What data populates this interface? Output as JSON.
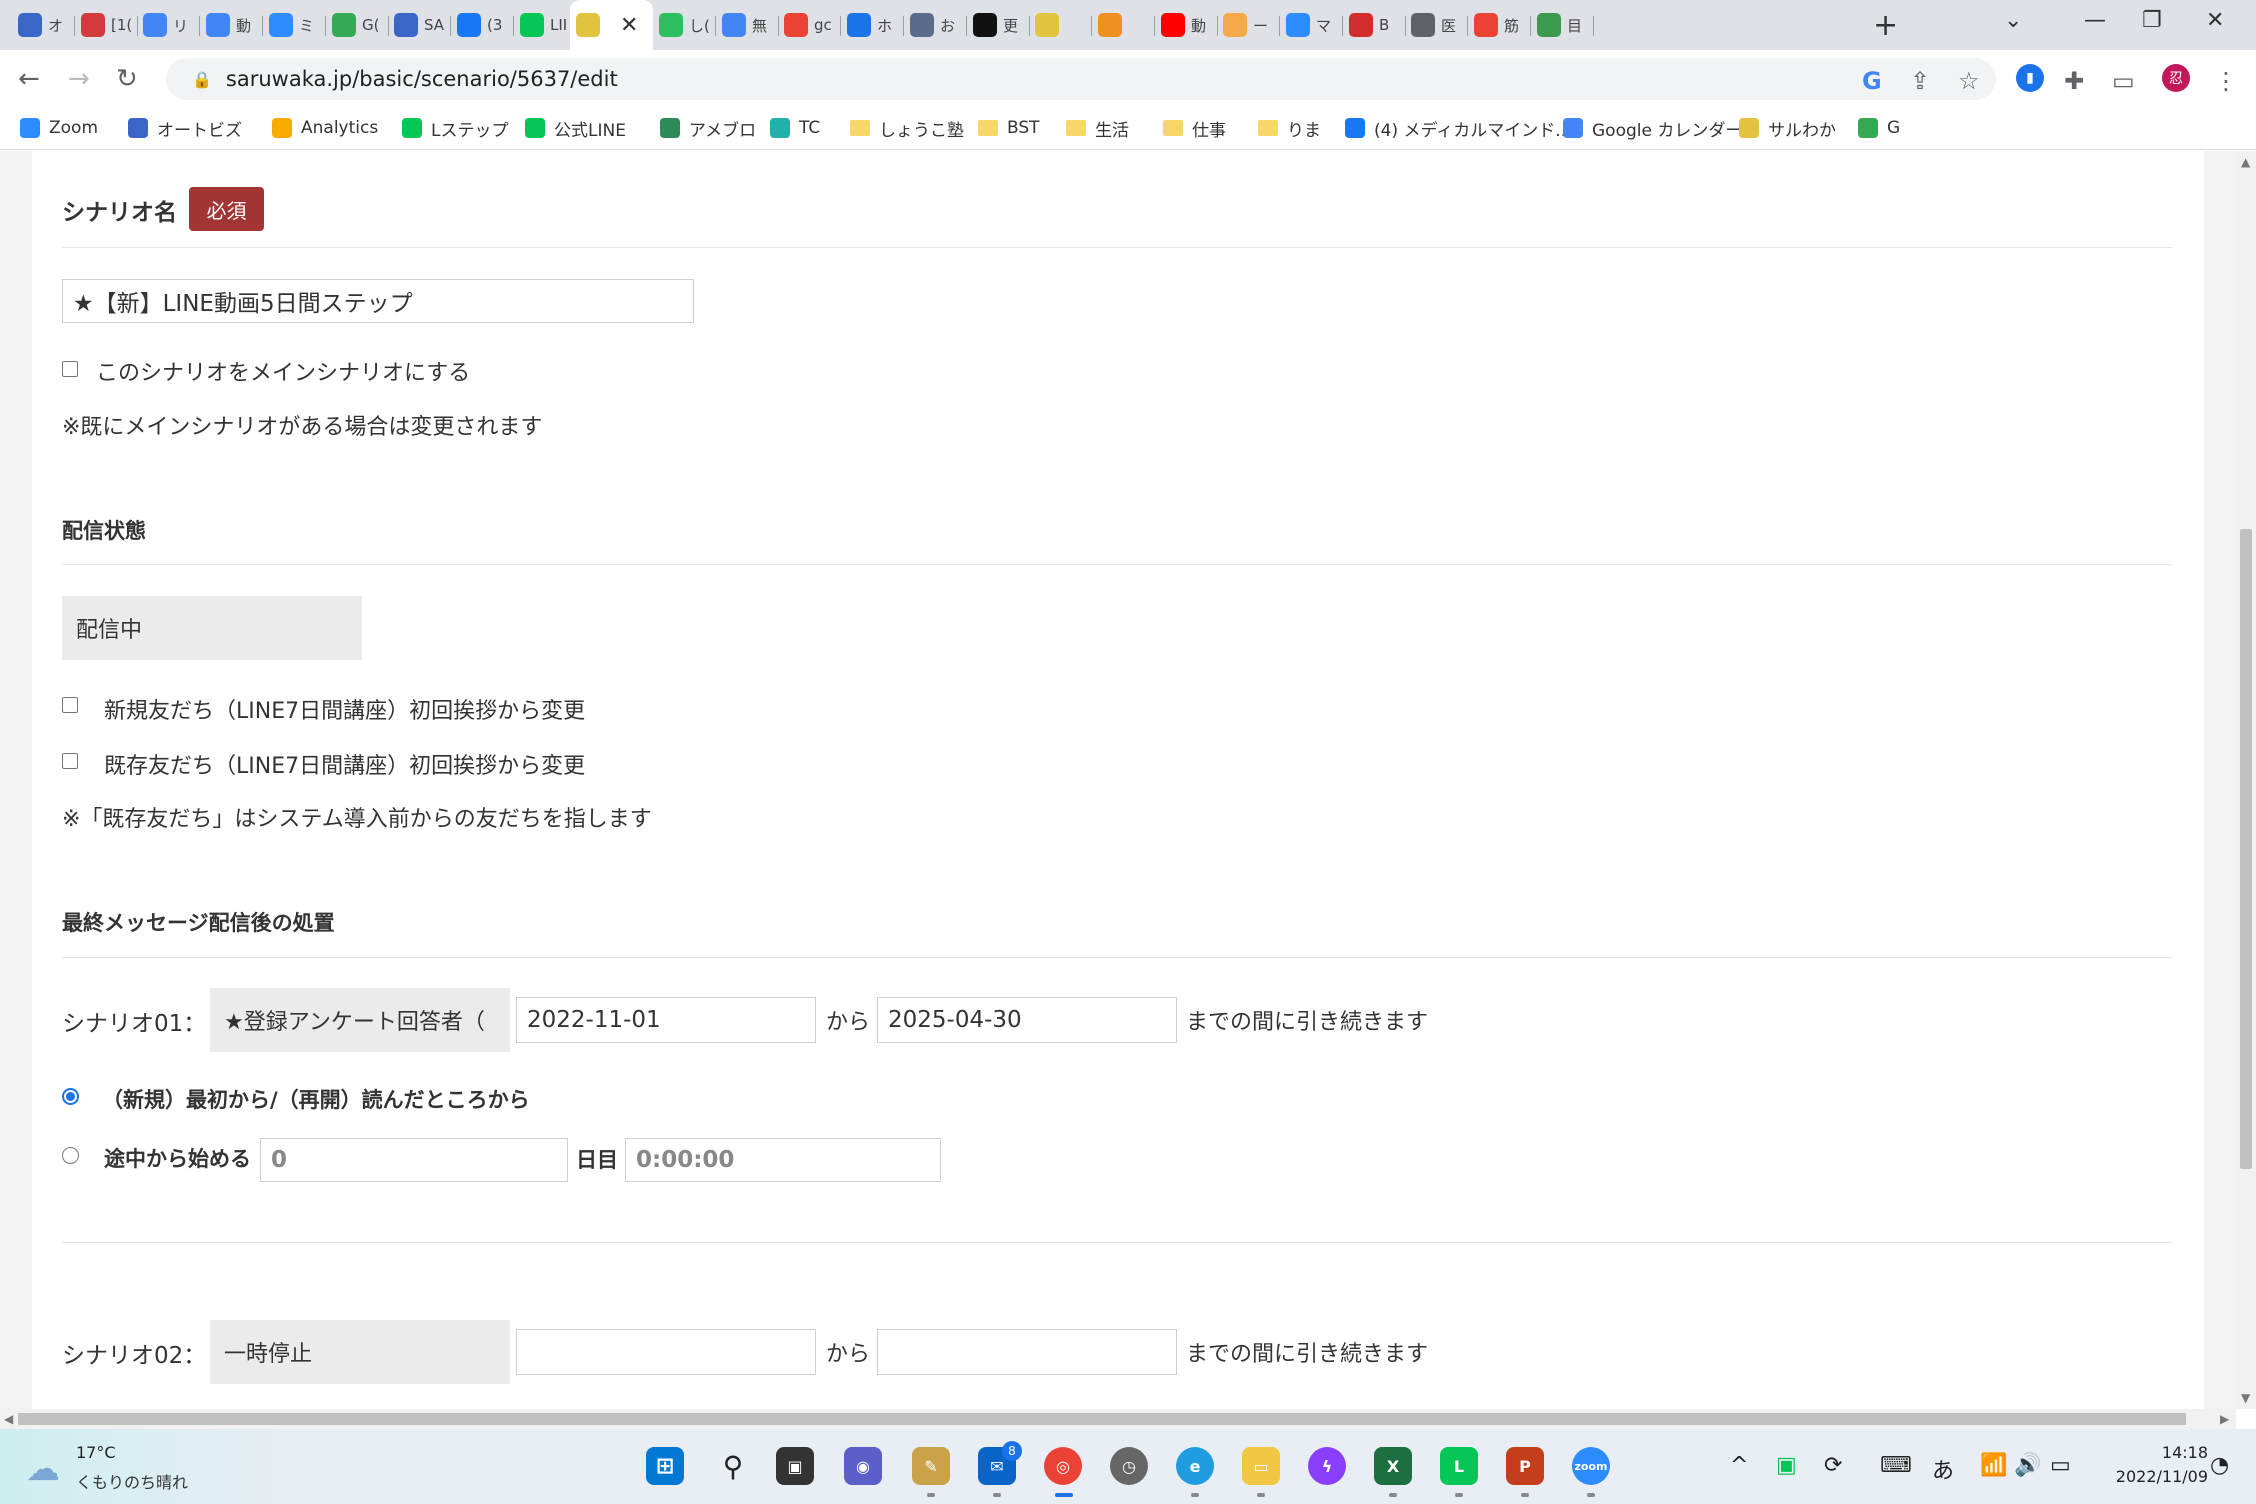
{
  "browser": {
    "tabs": [
      {
        "label": "オ",
        "icon": "beta-icon",
        "color": "#3a66c9"
      },
      {
        "label": "[1(",
        "icon": "flower-icon",
        "color": "#d23b3b"
      },
      {
        "label": "リ",
        "icon": "docs-icon",
        "color": "#4285f4"
      },
      {
        "label": "動",
        "icon": "docs-icon",
        "color": "#4285f4"
      },
      {
        "label": "ミ",
        "icon": "zoom-icon",
        "color": "#2d8cff"
      },
      {
        "label": "G(",
        "icon": "calendar-icon",
        "color": "#34a853"
      },
      {
        "label": "SA",
        "icon": "b-icon",
        "color": "#3a66c9"
      },
      {
        "label": "(3",
        "icon": "facebook-icon",
        "color": "#1877f2"
      },
      {
        "label": "LII",
        "icon": "line-shield-icon",
        "color": "#06c755"
      },
      {
        "label": "",
        "icon": "monkey-icon",
        "color": "#e3c441",
        "active": true
      },
      {
        "label": "し(",
        "icon": "evernote-icon",
        "color": "#2dbe60"
      },
      {
        "label": "無",
        "icon": "docs-icon",
        "color": "#4285f4"
      },
      {
        "label": "gc",
        "icon": "google-icon",
        "color": "#ea4335"
      },
      {
        "label": "ホ",
        "icon": "e-icon",
        "color": "#1a73e8"
      },
      {
        "label": "お",
        "icon": "zine-icon",
        "color": "#5b6b8c"
      },
      {
        "label": "更",
        "icon": "k-icon",
        "color": "#111111"
      },
      {
        "label": "",
        "icon": "monkey-icon",
        "color": "#e3c441"
      },
      {
        "label": "",
        "icon": "t-icon",
        "color": "#f09020"
      },
      {
        "label": "動",
        "icon": "youtube-icon",
        "color": "#ff0000"
      },
      {
        "label": "ー",
        "icon": "orange-star-icon",
        "color": "#f6a94a"
      },
      {
        "label": "マ",
        "icon": "zoom-icon",
        "color": "#2d8cff"
      },
      {
        "label": "B",
        "icon": "alpha-icon",
        "color": "#d22d2d"
      },
      {
        "label": "医",
        "icon": "globe-icon",
        "color": "#5f6368"
      },
      {
        "label": "筋",
        "icon": "google-icon",
        "color": "#ea4335"
      },
      {
        "label": "目",
        "icon": "frog-icon",
        "color": "#3c9a4e"
      }
    ],
    "active_tab_close": "✕",
    "new_tab": "+",
    "url": "saruwaka.jp/basic/scenario/5637/edit",
    "profile_initial": "忍",
    "bookmarks": [
      {
        "label": "Zoom",
        "icon": "zoom-icon",
        "color": "#2d8cff"
      },
      {
        "label": "オートビズ",
        "icon": "beta-icon",
        "color": "#3a66c9"
      },
      {
        "label": "Analytics",
        "icon": "analytics-icon",
        "color": "#f9ab00"
      },
      {
        "label": "Lステップ",
        "icon": "lstep-icon",
        "color": "#06c755"
      },
      {
        "label": "公式LINE",
        "icon": "line-shield-icon",
        "color": "#06c755"
      },
      {
        "label": "アメブロ",
        "icon": "ameba-icon",
        "color": "#2e8b57"
      },
      {
        "label": "TC",
        "icon": "tc-icon",
        "color": "#20b2aa"
      },
      {
        "label": "しょうこ塾",
        "icon": "folder-icon",
        "color": "#f7d76a"
      },
      {
        "label": "BST",
        "icon": "folder-icon",
        "color": "#f7d76a"
      },
      {
        "label": "生活",
        "icon": "folder-icon",
        "color": "#f7d76a"
      },
      {
        "label": "仕事",
        "icon": "folder-icon",
        "color": "#f7d76a"
      },
      {
        "label": "りま",
        "icon": "folder-icon",
        "color": "#f7d76a"
      },
      {
        "label": "(4) メディカルマインド...",
        "icon": "facebook-icon",
        "color": "#1877f2"
      },
      {
        "label": "Google カレンダー",
        "icon": "calendar-icon",
        "color": "#4285f4"
      },
      {
        "label": "サルわか",
        "icon": "monkey-icon",
        "color": "#e3c441"
      },
      {
        "label": "G",
        "icon": "drive-icon",
        "color": "#34a853"
      }
    ]
  },
  "form": {
    "scenario_name": {
      "label": "シナリオ名",
      "required_badge": "必須",
      "value": "★【新】LINE動画5日間ステップ",
      "main_checkbox_label": "このシナリオをメインシナリオにする",
      "main_note": "※既にメインシナリオがある場合は変更されます"
    },
    "delivery": {
      "label": "配信状態",
      "status": "配信中",
      "new_friends_label": "新規友だち（LINE7日間講座）初回挨拶から変更",
      "existing_friends_label": "既存友だち（LINE7日間講座）初回挨拶から変更",
      "note": "※「既存友だち」はシステム導入前からの友だちを指します"
    },
    "final": {
      "label": "最終メッセージ配信後の処置",
      "from_text": "から",
      "until_text": "までの間に引き続きます",
      "scenario01": {
        "label": "シナリオ01：",
        "target": "★登録アンケート回答者（",
        "start_date": "2022-11-01",
        "end_date": "2025-04-30"
      },
      "option_restart_label": "（新規）最初から/（再開）読んだところから",
      "option_midway_label": "途中から始める",
      "day_value": "0",
      "day_unit": "日目",
      "time_value": "0:00:00",
      "scenario02": {
        "label": "シナリオ02：",
        "target": "一時停止",
        "start_date": "",
        "end_date": ""
      }
    }
  },
  "taskbar": {
    "weather_temp": "17°C",
    "weather_condition": "くもりのち晴れ",
    "mail_badge": "8",
    "ime": "あ",
    "time": "14:18",
    "date": "2022/11/09"
  }
}
